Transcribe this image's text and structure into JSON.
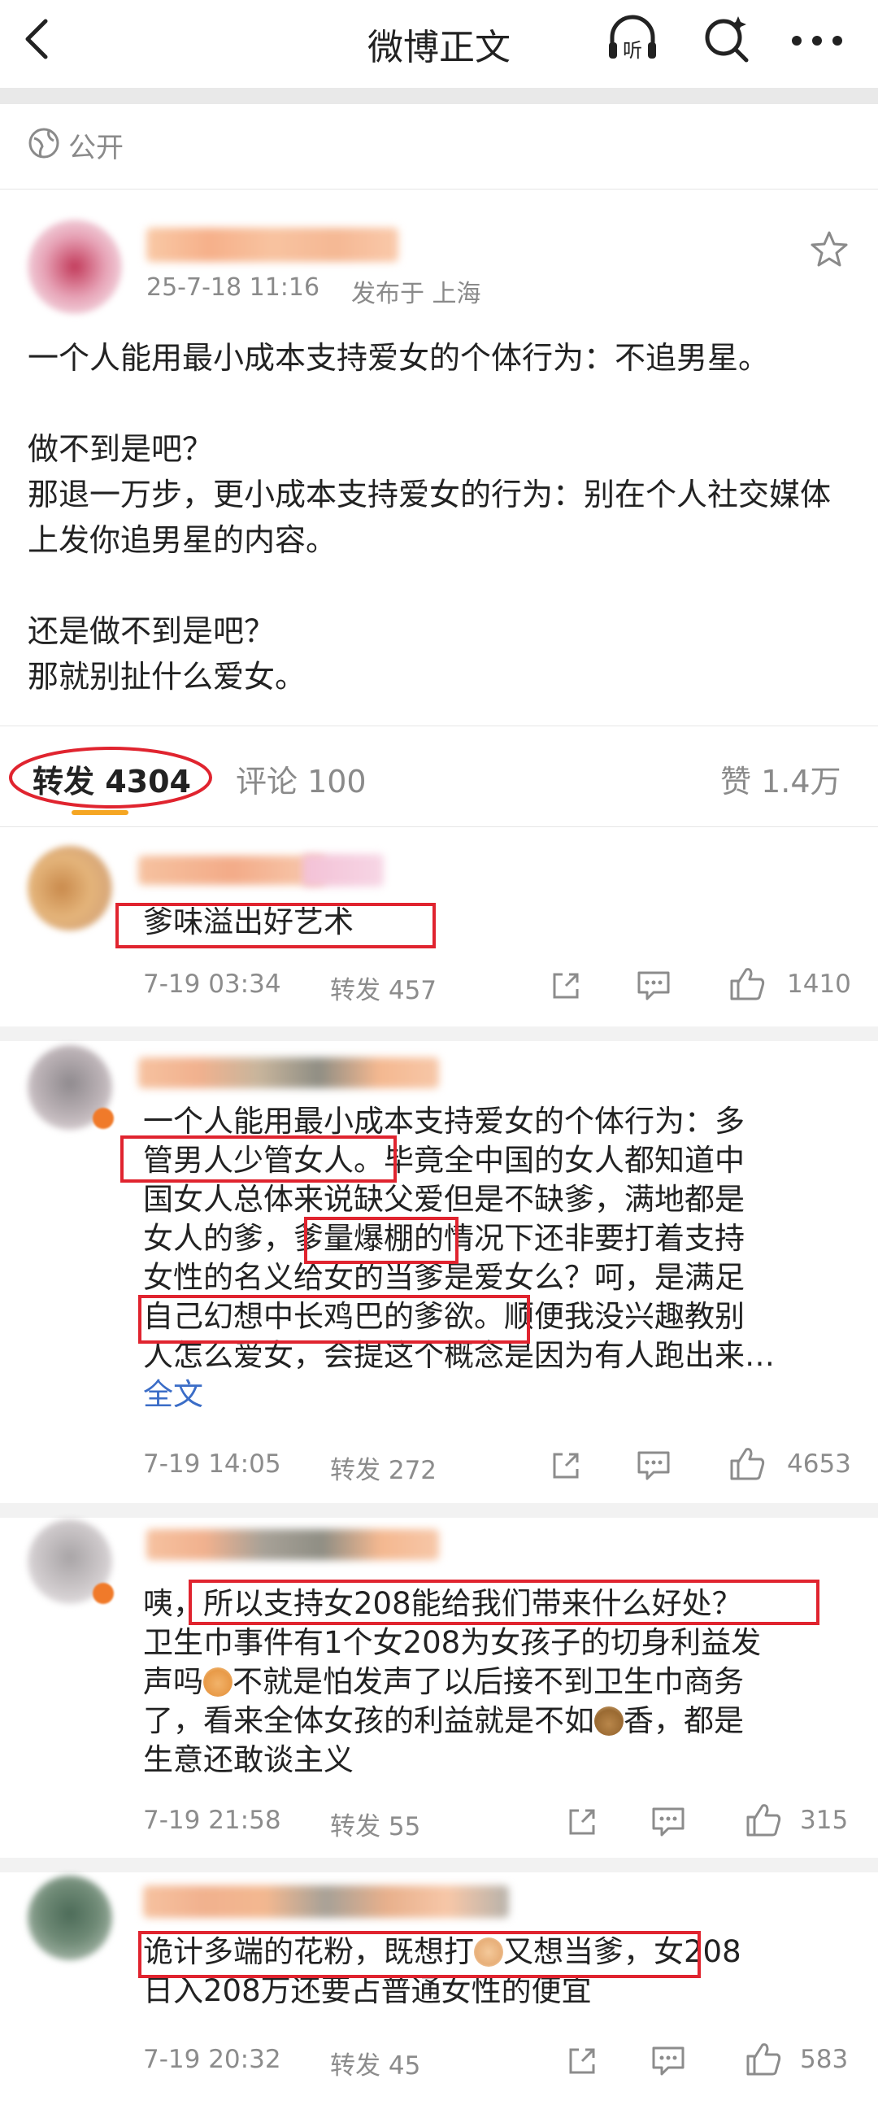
{
  "nav": {
    "title": "微博正文"
  },
  "visibility": {
    "label": "公开"
  },
  "post": {
    "timestamp": "25-7-18 11:16",
    "location": "发布于 上海",
    "paragraphs": [
      "一个人能用最小成本支持爱女的个体行为：不追男星。",
      "",
      "做不到是吧？",
      "那退一万步，更小成本支持爱女的行为：别在个人社交媒体上发你追男星的内容。",
      "",
      "还是做不到是吧？",
      "那就别扯什么爱女。"
    ]
  },
  "tabs": {
    "repost": "转发 4304",
    "comment": "评论 100",
    "likes": "赞 1.4万"
  },
  "reposts": [
    {
      "lines": [
        "爹味溢出好艺术"
      ],
      "date": "7-19 03:34",
      "repost": "转发 457",
      "likes": "1410"
    },
    {
      "lines": [
        "一个人能用最小成本支持爱女的个体行为：多",
        "管男人少管女人。毕竟全中国的女人都知道中",
        "国女人总体来说缺父爱但是不缺爹，满地都是",
        "女人的爹，爹量爆棚的情况下还非要打着支持",
        "女性的名义给女的当爹是爱女么？呵，是满足",
        "自己幻想中长鸡巴的爹欲。顺便我没兴趣教别",
        "人怎么爱女，会提这个概念是因为有人跑出来…"
      ],
      "full": "全文",
      "date": "7-19 14:05",
      "repost": "转发 272",
      "likes": "4653"
    },
    {
      "lines": [
        "咦，所以支持女208能给我们带来什么好处？",
        "卫生巾事件有1个女208为女孩子的切身利益发",
        "声吗",
        "不就是怕发声了以后接不到卫生巾商务",
        "了，看来全体女孩的利益就是不如",
        "香，都是",
        "生意还敢谈主义"
      ],
      "date": "7-19 21:58",
      "repost": "转发 55",
      "likes": "315"
    },
    {
      "lines": [
        "诡计多端的花粉，既想打",
        "又想当爹，女208",
        "日入208万还要占普通女性的便宜"
      ],
      "date": "7-19 20:32",
      "repost": "转发 45",
      "likes": "583"
    }
  ],
  "colors": {
    "highlight": "#e0242f",
    "link": "#3b6dc7",
    "muted": "#8c8c8c",
    "tab_underline": "#f5a623"
  },
  "icons": [
    "back-arrow-icon",
    "listen-icon",
    "search-icon",
    "more-icon",
    "globe-icon",
    "star-icon",
    "share-icon",
    "comment-icon",
    "like-icon",
    "dog-emoji",
    "money-bag-emoji",
    "fist-emoji"
  ]
}
